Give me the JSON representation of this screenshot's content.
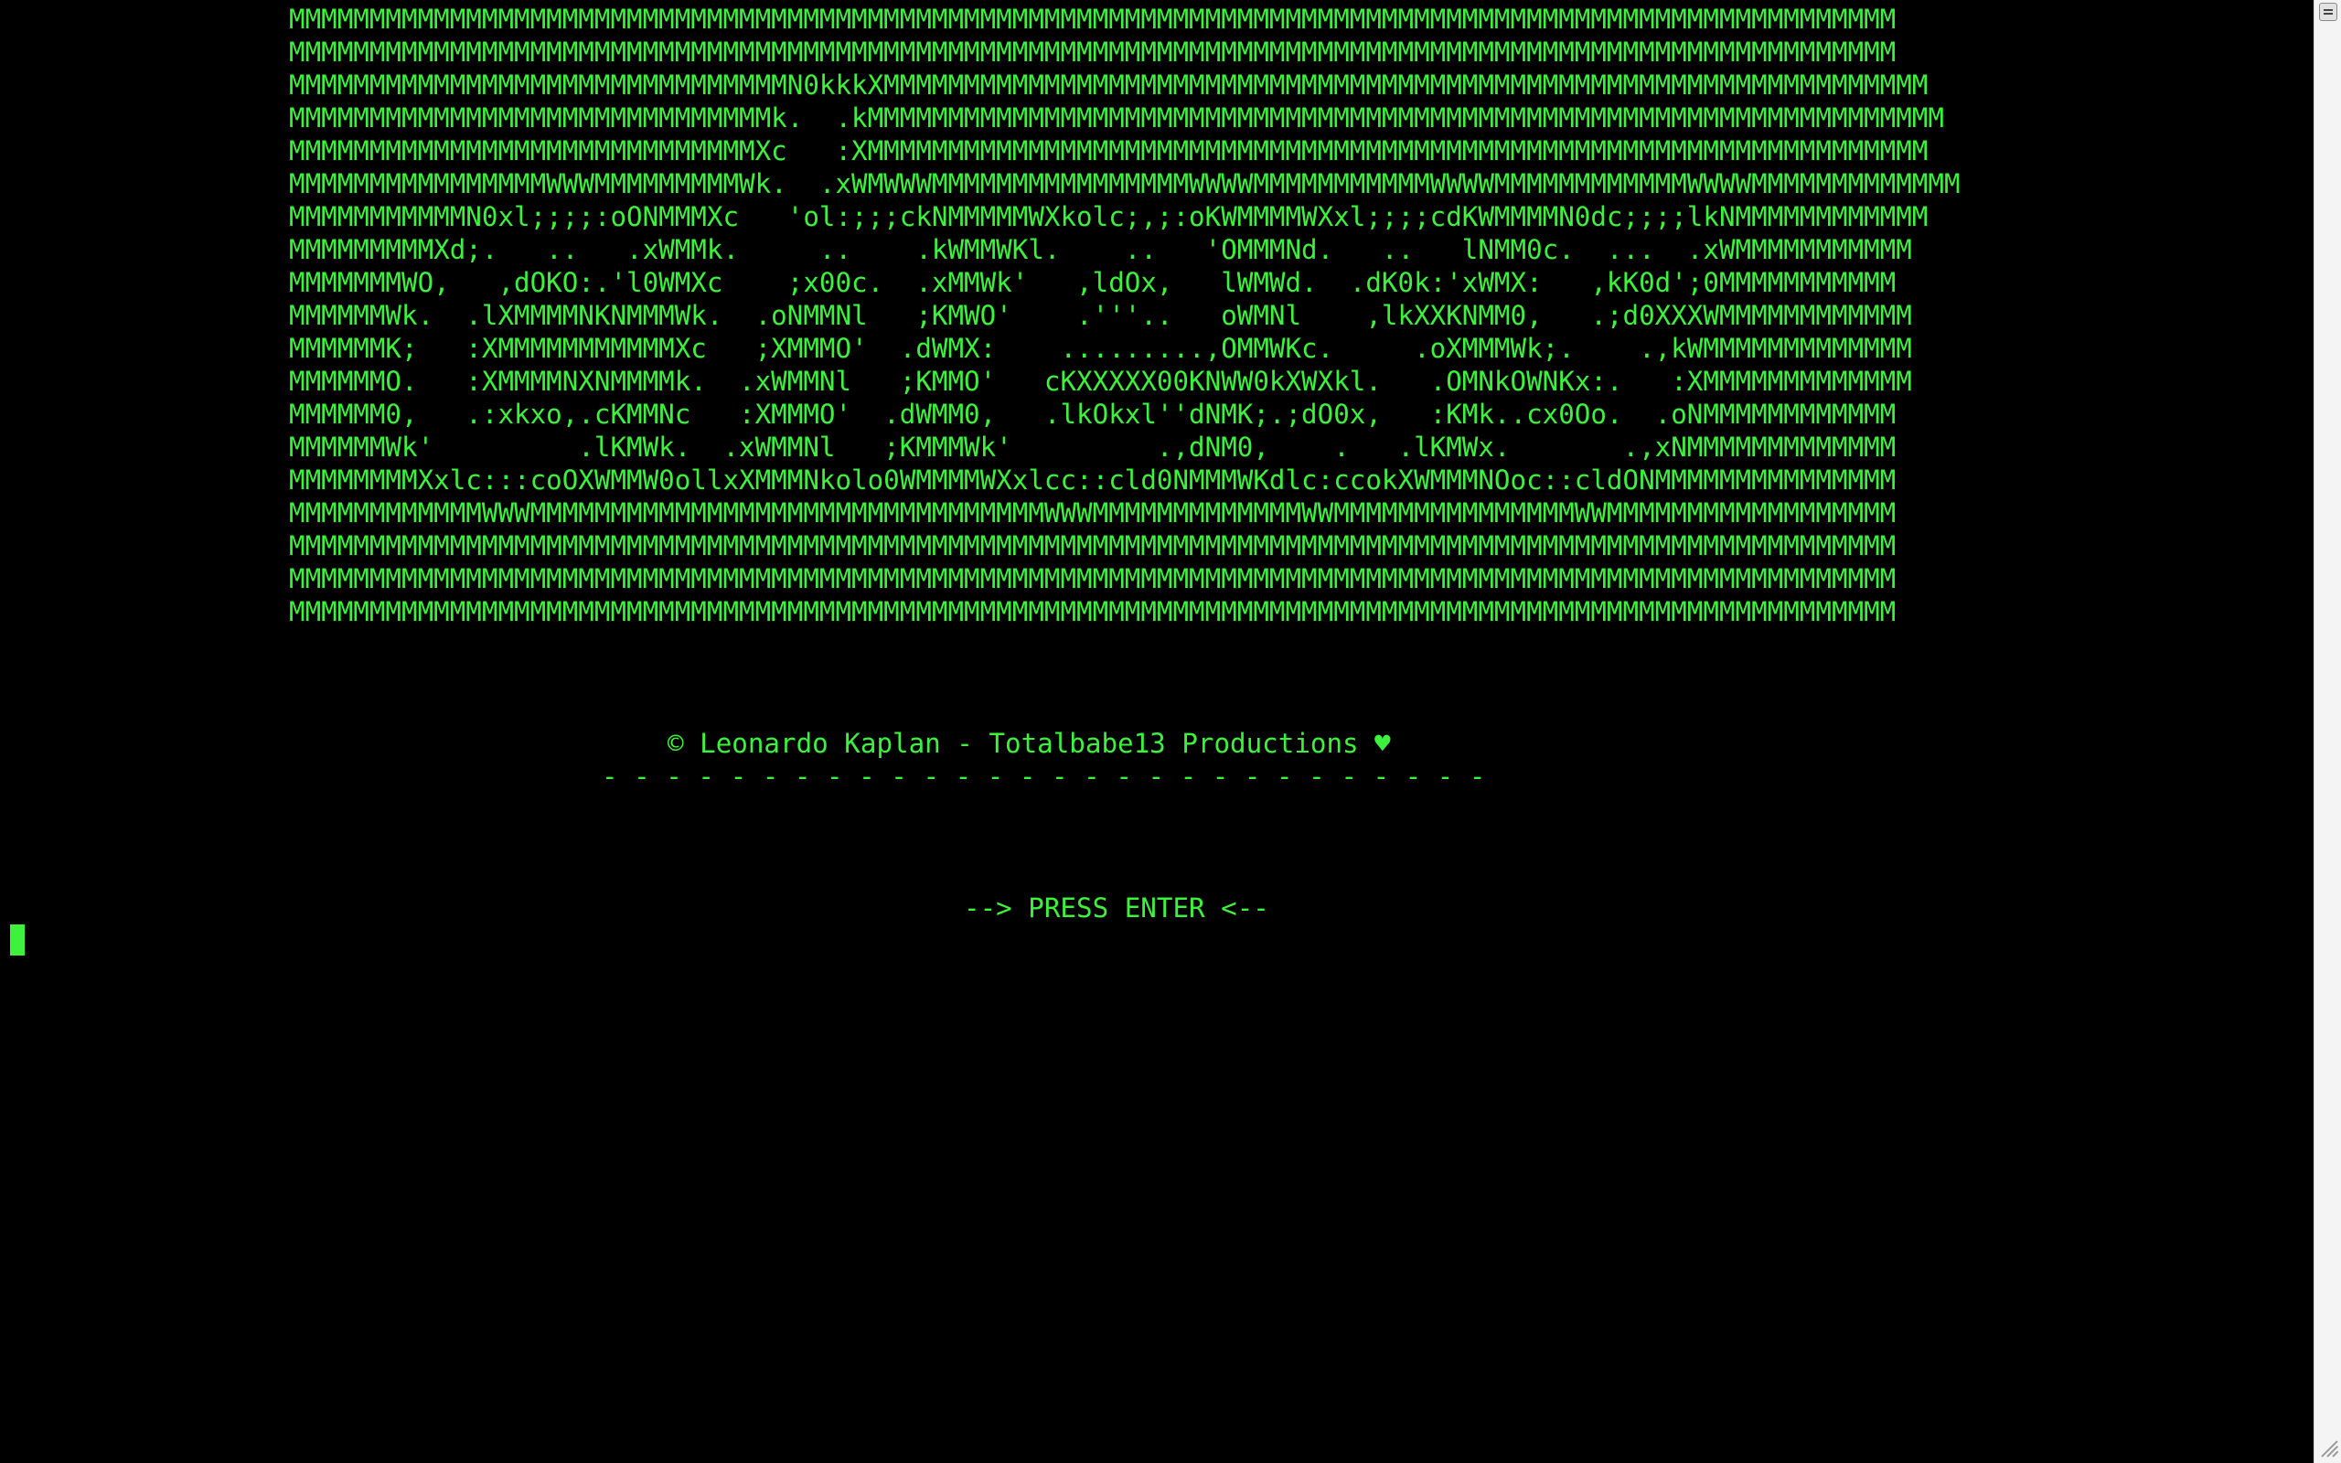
{
  "terminal": {
    "ascii_art": [
      "MMMMMMMMMMMMMMMMMMMMMMMMMMMMMMMMMMMMMMMMMMMMMMMMMMMMMMMMMMMMMMMMMMMMMMMMMMMMMMMMMMMMMMMMMMMMMMMMMMMM",
      "MMMMMMMMMMMMMMMMMMMMMMMMMMMMMMMMMMMMMMMMMMMMMMMMMMMMMMMMMMMMMMMMMMMMMMMMMMMMMMMMMMMMMMMMMMMMMMMMMMMM",
      "MMMMMMMMMMMMMMMMMMMMMMMMMMMMMMMN0kkkXMMMMMMMMMMMMMMMMMMMMMMMMMMMMMMMMMMMMMMMMMMMMMMMMMMMMMMMMMMMMMMMMM",
      "MMMMMMMMMMMMMMMMMMMMMMMMMMMMMMk.  .kMMMMMMMMMMMMMMMMMMMMMMMMMMMMMMMMMMMMMMMMMMMMMMMMMMMMMMMMMMMMMMMMMMM",
      "MMMMMMMMMMMMMMMMMMMMMMMMMMMMMXc   :XMMMMMMMMMMMMMMMMMMMMMMMMMMMMMMMMMMMMMMMMMMMMMMMMMMMMMMMMMMMMMMMMMM",
      "MMMMMMMMMMMMMMMMWWWMMMMMMMMMWk.  .xWMWWWMMMMMMMMMMMMMMMMWWWWMMMMMMMMMMMWWWWMMMMMMMMMMMMWWWWMMMMMMMMMMMMM",
      "MMMMMMMMMMMN0xl;;;;:oONMMMXc   'ol:;;;ckNMMMMMWXkolc;,;:oKWMMMMWXxl;;;;cdKWMMMMN0dc;;;;lkNMMMMMMMMMMMM",
      "MMMMMMMMMXd;.   ..   .xWMMk.     ..    .kWMMWKl.    ..   'OMMMNd.   ..   lNMM0c.  ...  .xWMMMMMMMMMMM",
      "MMMMMMMWO,   ,dOKO:.'l0WMXc    ;x00c.  .xMMWk'   ,ldOx,   lWMWd.  .dK0k:'xWMX:   ,kK0d';0MMMMMMMMMMM",
      "MMMMMMWk.  .lXMMMMNKNMMMWk.  .oNMMNl   ;KMWO'    .'''..   oWMNl    ,lkXXKNMM0,   .;d0XXXWMMMMMMMMMMMM",
      "MMMMMMK;   :XMMMMMMMMMMMXc   ;XMMMO'  .dWMX:    .........,OMMWKc.     .oXMMMWk;.    .,kWMMMMMMMMMMMMM",
      "MMMMMMO.   :XMMMMNXNMMMMk.  .xWMMNl   ;KMMO'   cKXXXXX00KNWW0kXWXkl.   .OMNkOWNKx:.   :XMMMMMMMMMMMMM",
      "MMMMMM0,   .:xkxo,.cKMMNc   :XMMMO'  .dWMM0,   .lkOkxl''dNMK;.;dO0x,   :KMk..cx0Oo.  .oNMMMMMMMMMMMM",
      "MMMMMMWk'         .lKMWk.  .xWMMNl   ;KMMMWk'         .,dNM0,    .   .lKMWx.       .,xNMMMMMMMMMMMMM",
      "MMMMMMMMXxlc:::coOXWMMW0ollxXMMMNkolo0WMMMMWXxlcc::cld0NMMMWKdlc:ccokXWMMMNOoc::cldONMMMMMMMMMMMMMMM",
      "MMMMMMMMMMMMWWWMMMMMMMMMMMMMMMMMMMMMMMMMMMMMMMMWWWMMMMMMMMMMMMMWWMMMMMMMMMMMMMMMWWMMMMMMMMMMMMMMMMMM",
      "MMMMMMMMMMMMMMMMMMMMMMMMMMMMMMMMMMMMMMMMMMMMMMMMMMMMMMMMMMMMMMMMMMMMMMMMMMMMMMMMMMMMMMMMMMMMMMMMMMMM",
      "MMMMMMMMMMMMMMMMMMMMMMMMMMMMMMMMMMMMMMMMMMMMMMMMMMMMMMMMMMMMMMMMMMMMMMMMMMMMMMMMMMMMMMMMMMMMMMMMMMMM",
      "MMMMMMMMMMMMMMMMMMMMMMMMMMMMMMMMMMMMMMMMMMMMMMMMMMMMMMMMMMMMMMMMMMMMMMMMMMMMMMMMMMMMMMMMMMMMMMMMMMMM"
    ],
    "credit": "© Leonardo Kaplan - Totalbabe13 Productions ♥",
    "separator": "- - - - - - - - - - - - - - - - - - - - - - - - - - - -",
    "prompt": "--> PRESS ENTER <--",
    "text_color": "#3cf23c",
    "background_color": "#000000"
  }
}
